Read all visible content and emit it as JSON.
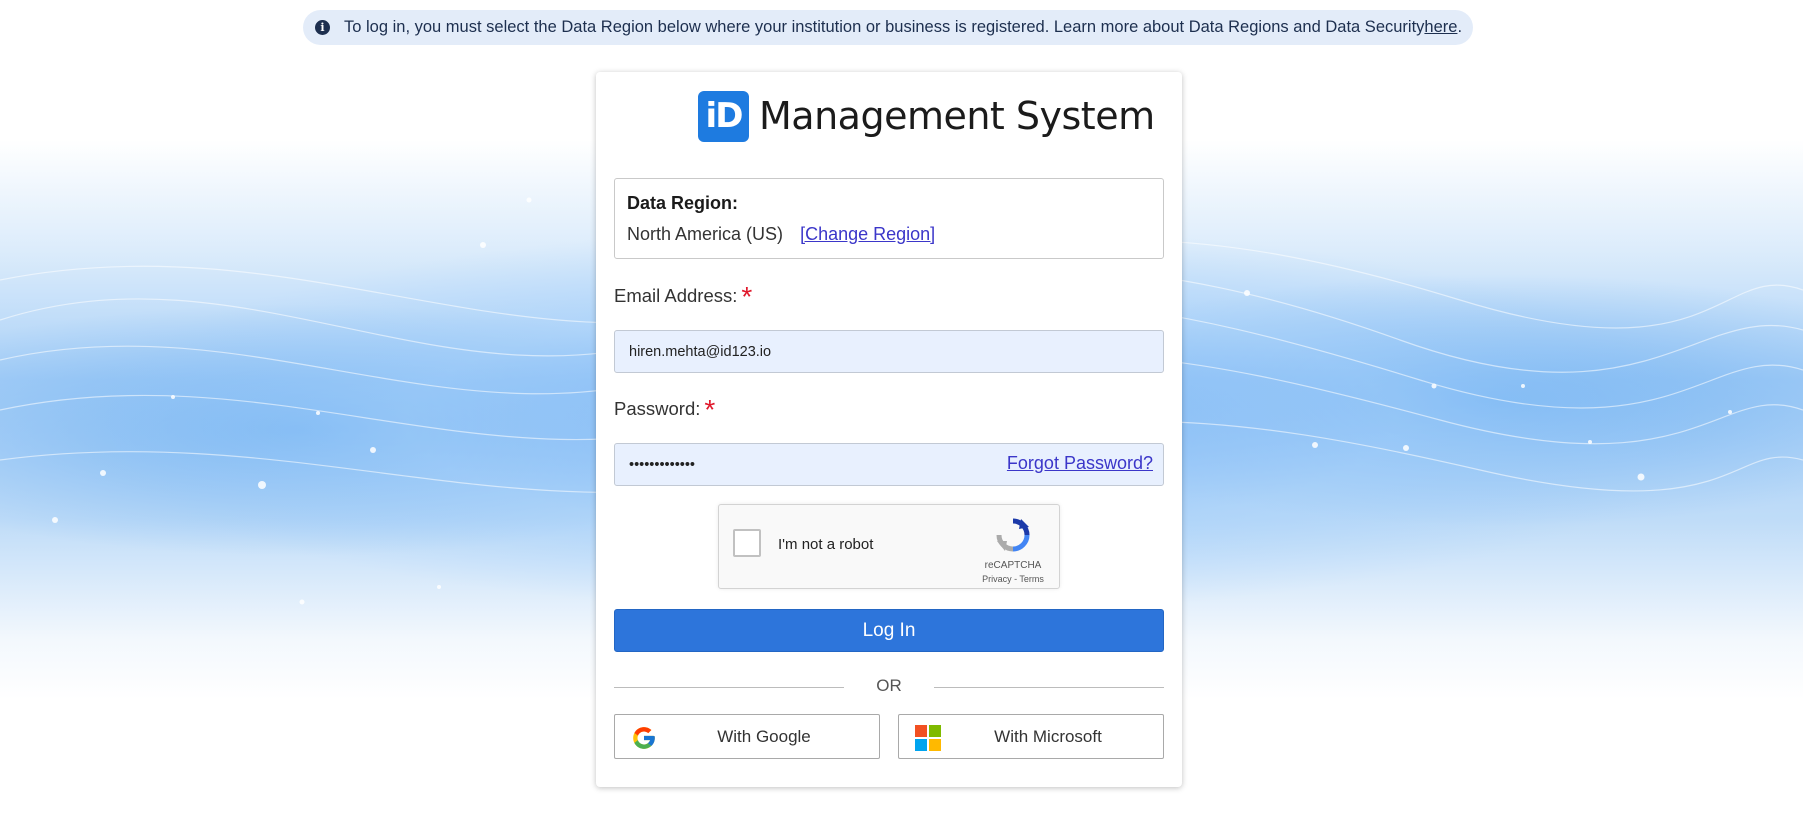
{
  "banner": {
    "text": "To log in, you must select the Data Region below where your institution or business is registered. Learn more about Data Regions and Data Security ",
    "link_text": "here",
    "suffix": ".",
    "icon": "info-icon"
  },
  "logo": {
    "mark": "iD",
    "title": "Management System"
  },
  "region": {
    "label": "Data Region:",
    "value": "North America (US)",
    "change_link": "[Change Region]"
  },
  "email": {
    "label": "Email Address:",
    "required_mark": "*",
    "value": "hiren.mehta@id123.io"
  },
  "password": {
    "label": "Password:",
    "required_mark": "*",
    "value": "•••••••••••••",
    "forgot_link": "Forgot Password?"
  },
  "captcha": {
    "label": "I'm not a robot",
    "brand": "reCAPTCHA",
    "links": "Privacy - Terms",
    "checked": false
  },
  "login_button": "Log In",
  "divider_text": "OR",
  "sso": {
    "google_label": "With Google",
    "microsoft_label": "With Microsoft"
  },
  "colors": {
    "primary_button": "#2d75db",
    "logo_tile": "#1e7be0",
    "link": "#3b36c9",
    "required": "#e0182b",
    "banner_bg": "#e3ecf9"
  }
}
